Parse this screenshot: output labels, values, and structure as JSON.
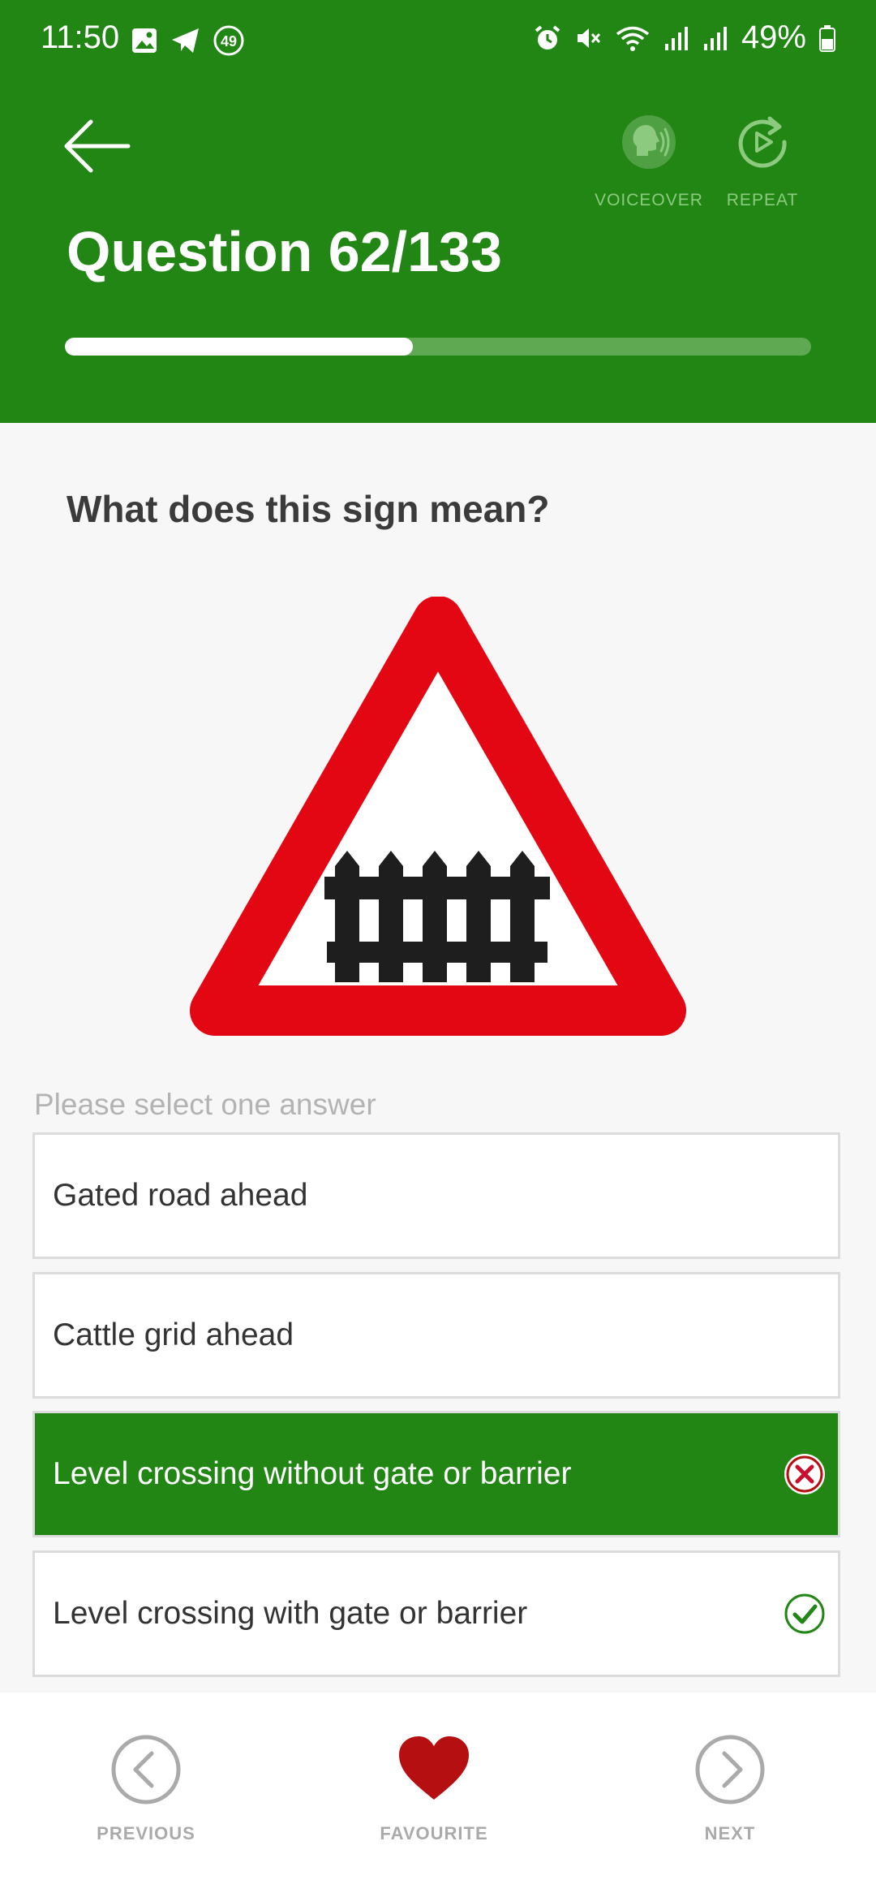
{
  "status_bar": {
    "time": "11:50",
    "notification_count": "49",
    "battery": "49%"
  },
  "header": {
    "voiceover_label": "VOICEOVER",
    "repeat_label": "REPEAT",
    "title": "Question 62/133",
    "progress_fraction": 0.466
  },
  "question": {
    "text": "What does this sign mean?",
    "sign": "level-crossing-with-gate-warning-sign",
    "hint": "Please select one answer"
  },
  "answers": [
    {
      "label": "Gated road ahead",
      "state": "default"
    },
    {
      "label": "Cattle grid ahead",
      "state": "default"
    },
    {
      "label": "Level crossing without gate or barrier",
      "state": "selected-wrong"
    },
    {
      "label": "Level crossing with gate or barrier",
      "state": "correct"
    }
  ],
  "colors": {
    "brand_green": "#218614",
    "heart_red": "#b50f12",
    "sign_red": "#e30613"
  },
  "bottom_nav": {
    "previous_label": "PREVIOUS",
    "favourite_label": "FAVOURITE",
    "next_label": "NEXT"
  }
}
